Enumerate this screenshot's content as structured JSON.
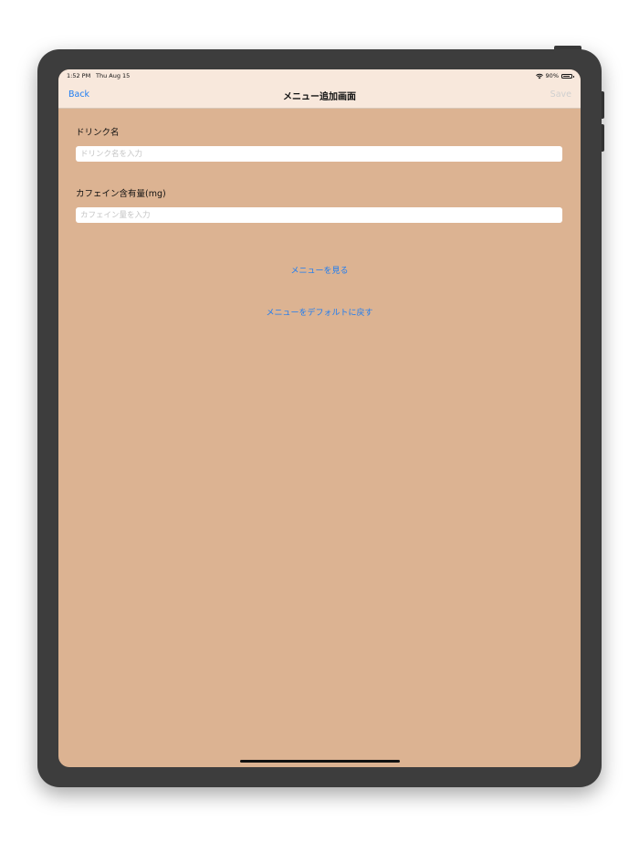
{
  "status_bar": {
    "time": "1:52 PM",
    "date": "Thu Aug 15",
    "battery_percent": "90%",
    "battery_level": 0.9
  },
  "nav": {
    "back_label": "Back",
    "title": "メニュー追加画面",
    "save_label": "Save"
  },
  "form": {
    "drink_name": {
      "label": "ドリンク名",
      "placeholder": "ドリンク名を入力",
      "value": ""
    },
    "caffeine": {
      "label": "カフェイン含有量(mg)",
      "placeholder": "カフェイン量を入力",
      "value": ""
    }
  },
  "actions": {
    "view_menu_label": "メニューを見る",
    "reset_menu_label": "メニューをデフォルトに戻す"
  },
  "colors": {
    "background": "#dcb392",
    "navbar": "#f8e8dc",
    "accent": "#1d7cf2",
    "disabled": "#cfcfcf"
  }
}
